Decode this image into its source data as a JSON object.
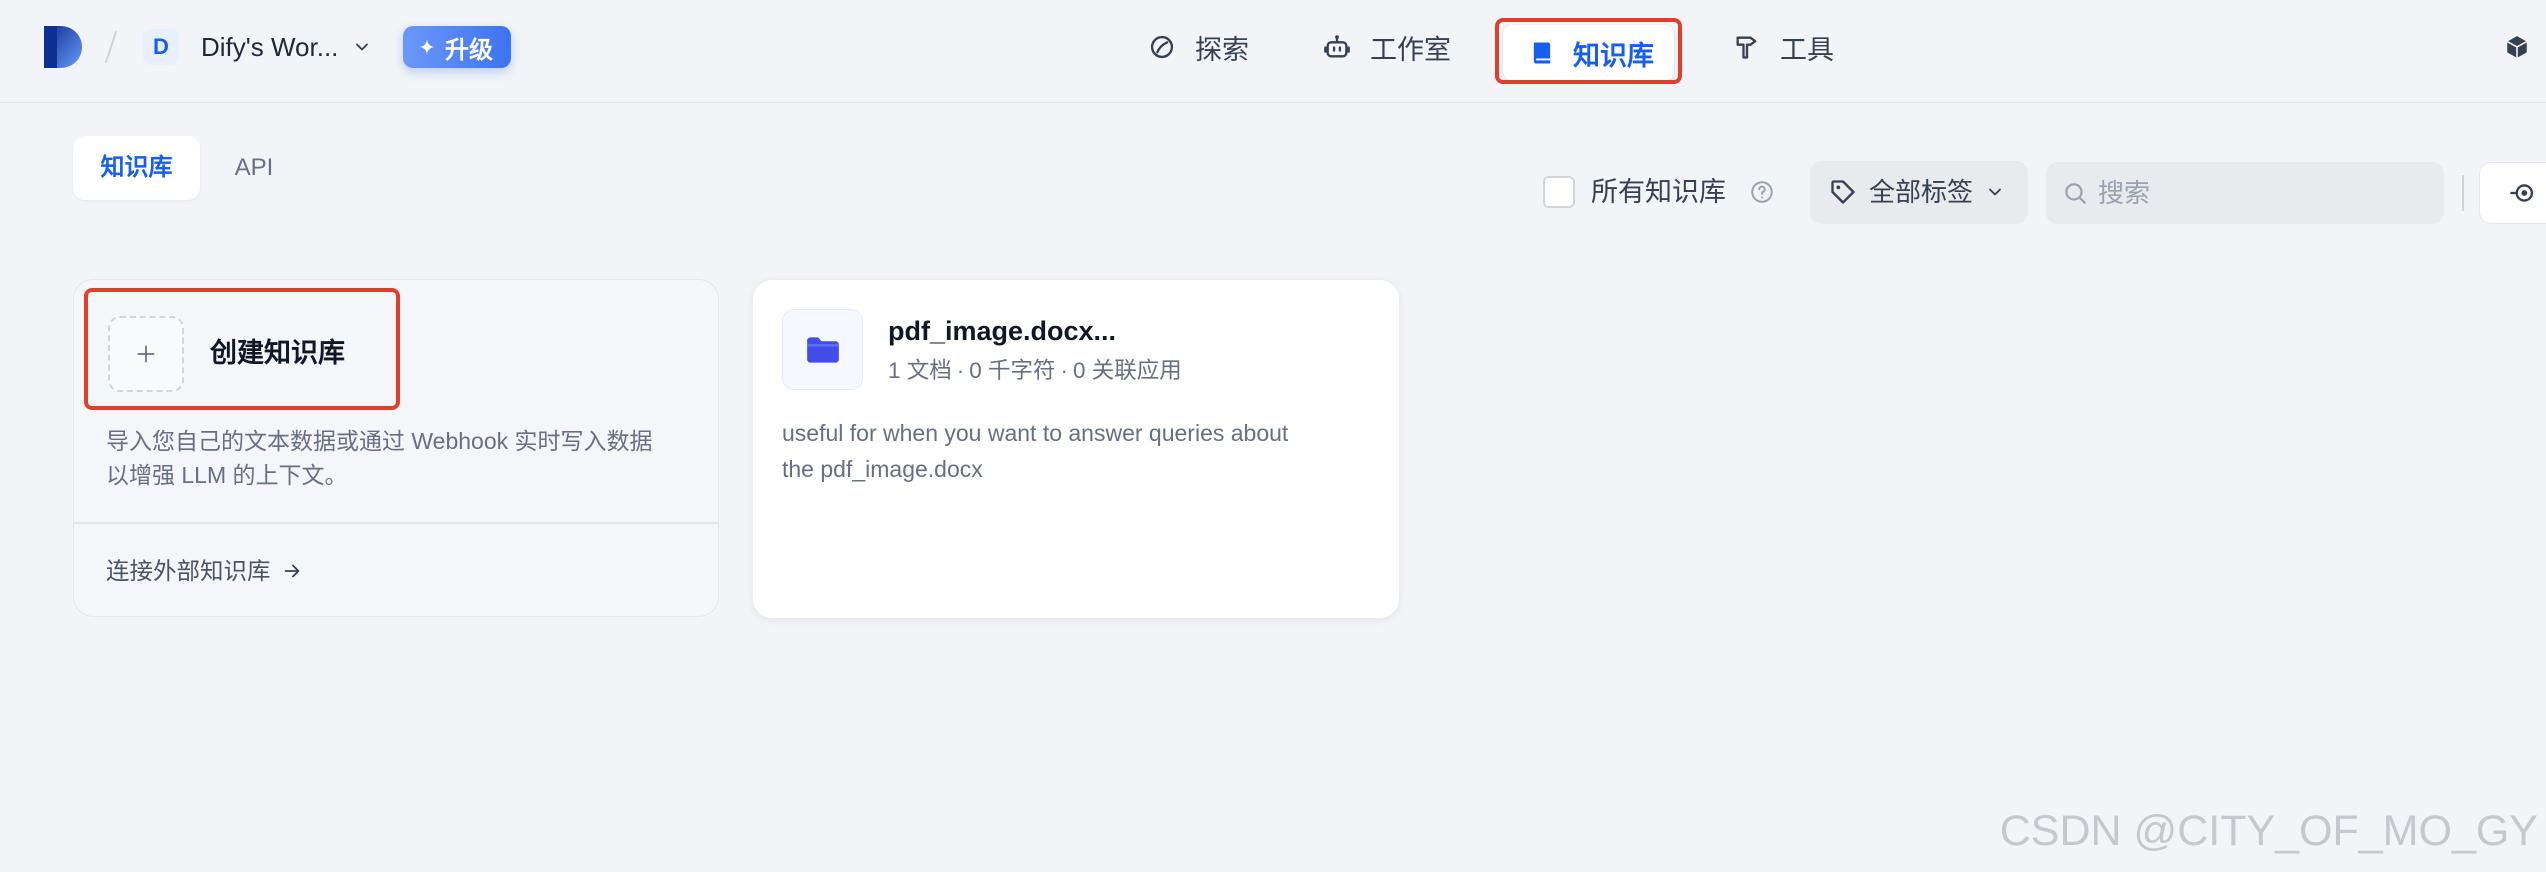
{
  "header": {
    "logo_icon": "dify-logo-icon",
    "workspace": {
      "avatar_letter": "D",
      "name": "Dify's Wor..."
    },
    "upgrade_icon": "sparkle-icon",
    "upgrade_label": "升级",
    "nav": [
      {
        "label": "探索",
        "icon": "explore-icon",
        "active": false
      },
      {
        "label": "工作室",
        "icon": "robot-icon",
        "active": false
      },
      {
        "label": "知识库",
        "icon": "book-icon",
        "active": true
      },
      {
        "label": "工具",
        "icon": "hammer-icon",
        "active": false
      }
    ],
    "right_icon": "cube-icon"
  },
  "tabs": [
    {
      "label": "知识库",
      "active": true
    },
    {
      "label": "API",
      "active": false
    }
  ],
  "filters": {
    "all_datasets_label": "所有知识库",
    "all_datasets_checked": false,
    "help_icon": "question-circle-icon",
    "tags_label": "全部标签",
    "tags_icon": "tag-icon",
    "search_placeholder": "搜索",
    "search_value": "",
    "external_api_icon": "api-connection-icon"
  },
  "create_card": {
    "icon": "plus-icon",
    "title": "创建知识库",
    "description_lines": [
      "导入您自己的文本数据或通过 Webhook 实时写入数据",
      "以增强 LLM 的上下文。"
    ],
    "connect_external_label": "连接外部知识库",
    "connect_icon": "arrow-right-icon"
  },
  "meta_separator": "·",
  "datasets": [
    {
      "icon": "folder-icon",
      "name": "pdf_image.docx...",
      "meta": [
        "1 文档",
        "0 千字符",
        "0 关联应用"
      ],
      "description_lines": [
        "useful for when you want to answer queries about",
        "the pdf_image.docx"
      ]
    }
  ],
  "watermark": "CSDN @CITY_OF_MO_GY",
  "colors": {
    "accent": "#155eef",
    "highlight_annotation": "#e0402b",
    "page_bg": "#f2f4f7",
    "folder_icon": "#444ce7",
    "upgrade_gradient": [
      "#6b98f8",
      "#3d73f0"
    ]
  }
}
